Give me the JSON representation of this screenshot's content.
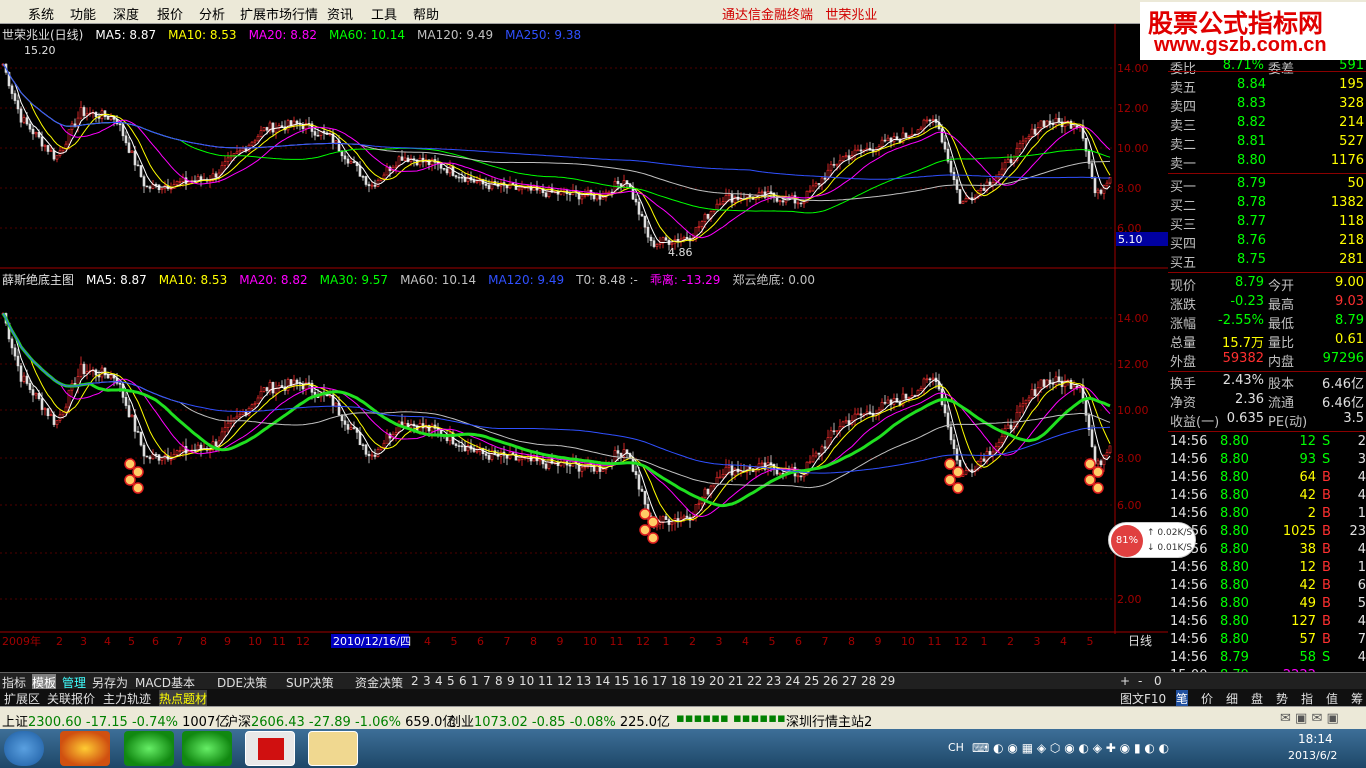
{
  "menubar": {
    "items": [
      "系统",
      "功能",
      "深度",
      "报价",
      "分析",
      "扩展市场行情",
      "资讯",
      "工具",
      "帮助"
    ],
    "title_left": "通达信金融终端",
    "title_right": "世荣兆业"
  },
  "watermark": {
    "line1": "股票公式指标网",
    "line2": "www.gszb.com.cn"
  },
  "top_chart": {
    "stock_label": "世荣兆业(日线)",
    "ma": [
      {
        "label": "MA5: 8.87",
        "color": "#ffffff"
      },
      {
        "label": "MA10: 8.53",
        "color": "#ffff00"
      },
      {
        "label": "MA20: 8.82",
        "color": "#ff00ff"
      },
      {
        "label": "MA60: 10.14",
        "color": "#00ff00"
      },
      {
        "label": "MA120: 9.49",
        "color": "#c0c0c0"
      },
      {
        "label": "MA250: 9.38",
        "color": "#3050ff"
      }
    ],
    "high_label": "15.20",
    "low_label": "4.86",
    "price_ticks": [
      "14.00",
      "12.00",
      "10.00",
      "8.00",
      "6.00"
    ],
    "cursor_price": "5.10"
  },
  "bottom_chart": {
    "indicator_name": "薛斯绝底主图",
    "params": [
      {
        "label": "MA5: 8.87",
        "color": "#ffffff"
      },
      {
        "label": "MA10: 8.53",
        "color": "#ffff00"
      },
      {
        "label": "MA20: 8.82",
        "color": "#ff00ff"
      },
      {
        "label": "MA30: 9.57",
        "color": "#00ff00"
      },
      {
        "label": "MA60: 10.14",
        "color": "#c0c0c0"
      },
      {
        "label": "MA120: 9.49",
        "color": "#3050ff"
      },
      {
        "label": "T0: 8.48 :-",
        "color": "#c0c0c0"
      },
      {
        "label": "乖离: -13.29",
        "color": "#ff00ff"
      },
      {
        "label": "郑云绝底: 0.00",
        "color": "#c0c0c0"
      }
    ],
    "price_ticks": [
      "14.00",
      "12.00",
      "10.00",
      "8.00",
      "6.00",
      "2.00"
    ]
  },
  "time_axis": {
    "year_label": "2009年",
    "labels": [
      "2",
      "3",
      "4",
      "5",
      "6",
      "7",
      "8",
      "9",
      "10",
      "11",
      "12"
    ],
    "cursor_date": "2010/12/16/四",
    "labels2": [
      "4",
      "5",
      "6",
      "7",
      "8",
      "9",
      "10",
      "11",
      "12",
      "1",
      "2",
      "3",
      "4",
      "5",
      "6",
      "7",
      "8",
      "9",
      "10",
      "11",
      "12",
      "1",
      "2",
      "3",
      "4",
      "5"
    ],
    "period": "日线"
  },
  "tabs_row1": [
    "指标",
    "模板",
    "管理",
    "另存为",
    "MACD基本",
    "DDE决策",
    "SUP决策",
    "资金决策",
    "2",
    "3",
    "4",
    "5",
    "6",
    "1",
    "7",
    "8",
    "9",
    "10",
    "11",
    "12",
    "13",
    "14",
    "15",
    "16",
    "17",
    "18",
    "19",
    "20",
    "21",
    "22",
    "23",
    "24",
    "25",
    "26",
    "27",
    "28",
    "29"
  ],
  "tabs_row2": [
    "扩展区",
    "关联报价",
    "主力轨迹",
    "热点题材"
  ],
  "tabs_right": [
    "图文F10",
    "笔",
    "价",
    "细",
    "盘",
    "势",
    "指",
    "值",
    "筹"
  ],
  "quote": {
    "header": {
      "label1": "委比",
      "val1": "8.71%",
      "label2": "委差",
      "val2": "591"
    },
    "sell": [
      {
        "label": "卖五",
        "price": "8.84",
        "vol": "195"
      },
      {
        "label": "卖四",
        "price": "8.83",
        "vol": "328"
      },
      {
        "label": "卖三",
        "price": "8.82",
        "vol": "214"
      },
      {
        "label": "卖二",
        "price": "8.81",
        "vol": "527"
      },
      {
        "label": "卖一",
        "price": "8.80",
        "vol": "1176"
      }
    ],
    "buy": [
      {
        "label": "买一",
        "price": "8.79",
        "vol": "50"
      },
      {
        "label": "买二",
        "price": "8.78",
        "vol": "1382"
      },
      {
        "label": "买三",
        "price": "8.77",
        "vol": "118"
      },
      {
        "label": "买四",
        "price": "8.76",
        "vol": "218"
      },
      {
        "label": "买五",
        "price": "8.75",
        "vol": "281"
      }
    ],
    "stats": [
      {
        "l1": "现价",
        "v1": "8.79",
        "c1": "#00ff00",
        "l2": "今开",
        "v2": "9.00",
        "c2": "#ffff00"
      },
      {
        "l1": "涨跌",
        "v1": "-0.23",
        "c1": "#00ff00",
        "l2": "最高",
        "v2": "9.03",
        "c2": "#ff3030"
      },
      {
        "l1": "涨幅",
        "v1": "-2.55%",
        "c1": "#00ff00",
        "l2": "最低",
        "v2": "8.79",
        "c2": "#00ff00"
      },
      {
        "l1": "总量",
        "v1": "15.7万",
        "c1": "#ffff00",
        "l2": "量比",
        "v2": "0.61",
        "c2": "#ffff00"
      },
      {
        "l1": "外盘",
        "v1": "59382",
        "c1": "#ff3030",
        "l2": "内盘",
        "v2": "97296",
        "c2": "#00ff00"
      }
    ],
    "stats2": [
      {
        "l1": "换手",
        "v1": "2.43%",
        "l2": "股本",
        "v2": "6.46亿"
      },
      {
        "l1": "净资",
        "v1": "2.36",
        "l2": "流通",
        "v2": "6.46亿"
      },
      {
        "l1": "收益(一)",
        "v1": "0.635",
        "l2": "PE(动)",
        "v2": "3.5"
      }
    ],
    "ticks": [
      {
        "t": "14:56",
        "p": "8.80",
        "v": "12",
        "bs": "S",
        "n": "2"
      },
      {
        "t": "14:56",
        "p": "8.80",
        "v": "93",
        "bs": "S",
        "n": "3"
      },
      {
        "t": "14:56",
        "p": "8.80",
        "v": "64",
        "bs": "B",
        "n": "4"
      },
      {
        "t": "14:56",
        "p": "8.80",
        "v": "42",
        "bs": "B",
        "n": "4"
      },
      {
        "t": "14:56",
        "p": "8.80",
        "v": "2",
        "bs": "B",
        "n": "1"
      },
      {
        "t": "14:56",
        "p": "8.80",
        "v": "1025",
        "bs": "B",
        "n": "23"
      },
      {
        "t": "14:56",
        "p": "8.80",
        "v": "38",
        "bs": "B",
        "n": "4"
      },
      {
        "t": "14:56",
        "p": "8.80",
        "v": "12",
        "bs": "B",
        "n": "1"
      },
      {
        "t": "14:56",
        "p": "8.80",
        "v": "42",
        "bs": "B",
        "n": "6"
      },
      {
        "t": "14:56",
        "p": "8.80",
        "v": "49",
        "bs": "B",
        "n": "5"
      },
      {
        "t": "14:56",
        "p": "8.80",
        "v": "127",
        "bs": "B",
        "n": "4"
      },
      {
        "t": "14:56",
        "p": "8.80",
        "v": "57",
        "bs": "B",
        "n": "7"
      },
      {
        "t": "14:56",
        "p": "8.79",
        "v": "58",
        "bs": "S",
        "n": "4"
      },
      {
        "t": "15:00",
        "p": "8.79",
        "v": "2222",
        "bs": "",
        "n": ""
      }
    ]
  },
  "speed": {
    "pct": "81%",
    "up": "0.02K/S",
    "down": "0.01K/S"
  },
  "status": {
    "sh_label": "上证",
    "sh_val": "2300.60",
    "sh_chg": "-17.15",
    "sh_pct": "-0.74%",
    "sh_amt": "1007亿",
    "hs_label": "沪深",
    "hs_val": "2606.43",
    "hs_chg": "-27.89",
    "hs_pct": "-1.06%",
    "hs_amt": "659.0亿",
    "cy_label": "创业",
    "cy_val": "1073.02",
    "cy_chg": "-0.85",
    "cy_pct": "-0.08%",
    "cy_amt": "225.0亿",
    "server": "深圳行情主站2"
  },
  "taskbar": {
    "lang": "CH",
    "time": "18:14",
    "date": "2013/6/2"
  }
}
